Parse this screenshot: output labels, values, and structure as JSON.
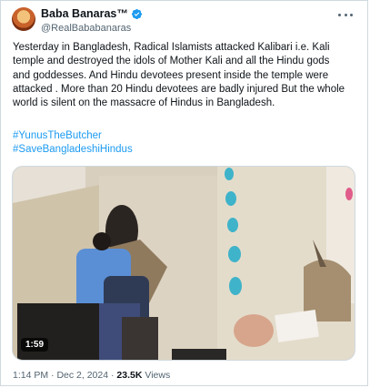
{
  "author": {
    "name": "Baba Banaras™",
    "handle": "@RealBababanaras"
  },
  "tweet": {
    "text": "Yesterday in Bangladesh, Radical Islamists attacked Kalibari i.e. Kali\ntemple and destroyed the idols of Mother Kali and all the Hindu gods\nand goddesses. And Hindu devotees present inside the temple were\nattacked . More than 20 Hindu devotees are badly injured But the whole\nworld is silent on the massacre of Hindus in Bangladesh.",
    "hashtags": [
      "#YunusTheButcher",
      "#SaveBangladeshiHindus"
    ]
  },
  "media": {
    "duration": "1:59"
  },
  "meta": {
    "time": "1:14 PM",
    "separator": "·",
    "date": "Dec 2, 2024",
    "views_count": "23.5K",
    "views_label": "Views"
  },
  "colors": {
    "accent": "#1d9bf0",
    "text": "#0f1419",
    "muted": "#536471"
  },
  "icons": [
    "verified-badge-icon",
    "more-options-icon"
  ]
}
